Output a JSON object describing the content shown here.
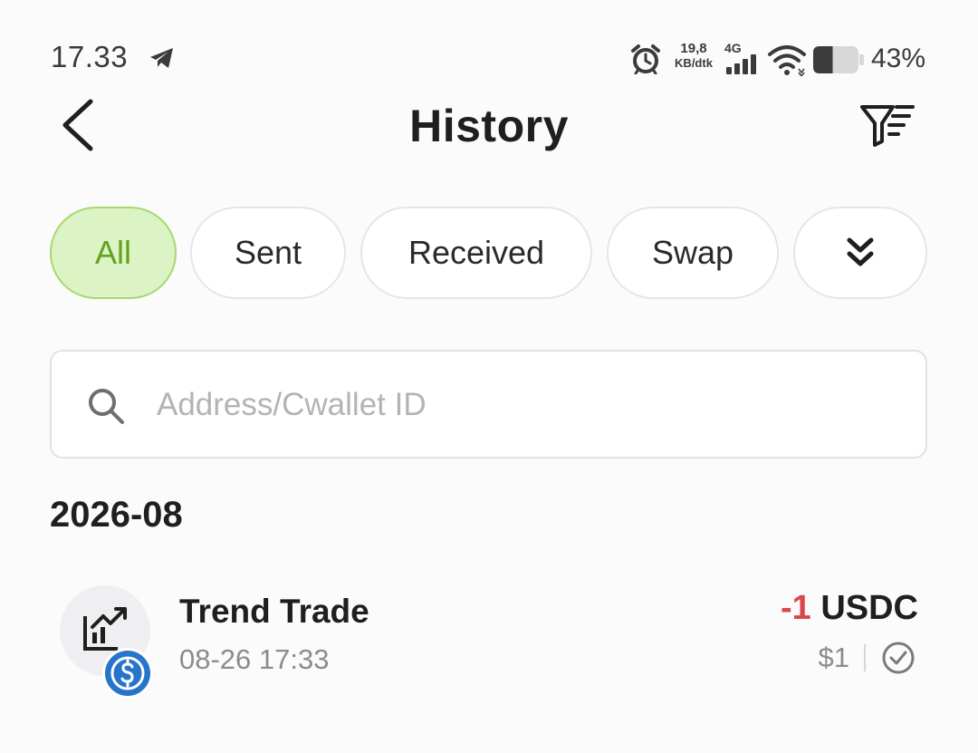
{
  "status_bar": {
    "time": "17.33",
    "net_speed_value": "19,8",
    "net_speed_unit": "KB/dtk",
    "network_type": "4G",
    "battery_percent": "43%",
    "battery_level": 0.43
  },
  "header": {
    "title": "History"
  },
  "filters": {
    "chips": [
      {
        "label": "All",
        "active": true
      },
      {
        "label": "Sent",
        "active": false
      },
      {
        "label": "Received",
        "active": false
      },
      {
        "label": "Swap",
        "active": false
      }
    ]
  },
  "search": {
    "value": "",
    "placeholder": "Address/Cwallet ID"
  },
  "history": {
    "month": "2026-08",
    "transactions": [
      {
        "name": "Trend Trade",
        "date": "08-26 17:33",
        "amount_sign": "-1",
        "currency": "USDC",
        "fiat": "$1",
        "status": "completed"
      }
    ]
  },
  "colors": {
    "accent_bg": "#dcf3c6",
    "accent_border": "#a6d96d",
    "accent_text": "#63a11e",
    "negative": "#d94848",
    "usdc_blue": "#2775ca"
  },
  "icons": [
    "telegram-icon",
    "alarm-icon",
    "signal-icon",
    "wifi-icon",
    "battery-icon",
    "back-icon",
    "filter-icon",
    "chevrons-down-icon",
    "search-icon",
    "trend-trade-icon",
    "usdc-icon",
    "check-circle-icon"
  ]
}
